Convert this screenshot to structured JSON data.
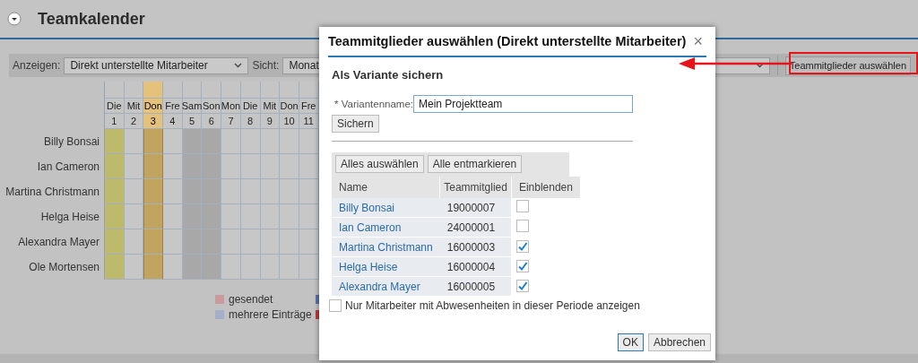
{
  "page": {
    "title": "Teamkalender"
  },
  "toolbar": {
    "show_label": "Anzeigen:",
    "show_value": "Direkt unterstellte Mitarbeiter",
    "view_label": "Sicht:",
    "view_value": "Monat",
    "members_button": "Teammitglieder auswählen"
  },
  "calendar": {
    "days": [
      {
        "weekday": "Die",
        "day": "1",
        "kind": "holiday"
      },
      {
        "weekday": "Mit",
        "day": "2",
        "kind": "normal"
      },
      {
        "weekday": "Don",
        "day": "3",
        "kind": "today"
      },
      {
        "weekday": "Fre",
        "day": "4",
        "kind": "normal"
      },
      {
        "weekday": "Sam",
        "day": "5",
        "kind": "weekend"
      },
      {
        "weekday": "Son",
        "day": "6",
        "kind": "weekend"
      },
      {
        "weekday": "Mon",
        "day": "7",
        "kind": "normal"
      },
      {
        "weekday": "Die",
        "day": "8",
        "kind": "normal"
      },
      {
        "weekday": "Mit",
        "day": "9",
        "kind": "normal"
      },
      {
        "weekday": "Don",
        "day": "10",
        "kind": "normal"
      },
      {
        "weekday": "Fre",
        "day": "11",
        "kind": "normal"
      }
    ],
    "employees": [
      "Billy Bonsai",
      "Ian Cameron",
      "Martina Christmann",
      "Helga Heise",
      "Alexandra Mayer",
      "Ole Mortensen"
    ],
    "legend": [
      {
        "label": "gesendet",
        "color": "#c89a9c"
      },
      {
        "label": "mehrere Einträge",
        "color": "#a3b0c8"
      },
      {
        "color": "#5a75b0"
      },
      {
        "color": "#c03a3a"
      }
    ]
  },
  "dialog": {
    "title": "Teammitglieder auswählen (Direkt unterstellte Mitarbeiter)",
    "close": "×",
    "section": "Als Variante sichern",
    "variant_label": "* Variantenname:",
    "variant_value": "Mein Projektteam",
    "save_button": "Sichern",
    "select_all": "Alles auswählen",
    "deselect_all": "Alle entmarkieren",
    "columns": [
      "Name",
      "Teammitglied",
      "Einblenden"
    ],
    "rows": [
      {
        "name": "Billy Bonsai",
        "id": "19000007",
        "checked": false
      },
      {
        "name": "Ian Cameron",
        "id": "24000001",
        "checked": false
      },
      {
        "name": "Martina Christmann",
        "id": "16000003",
        "checked": true
      },
      {
        "name": "Helga Heise",
        "id": "16000004",
        "checked": true
      },
      {
        "name": "Alexandra Mayer",
        "id": "16000005",
        "checked": true
      }
    ],
    "absences_only": {
      "label": "Nur Mitarbeiter mit Abwesenheiten in dieser Periode anzeigen",
      "checked": false
    },
    "ok": "OK",
    "cancel": "Abbrechen"
  }
}
